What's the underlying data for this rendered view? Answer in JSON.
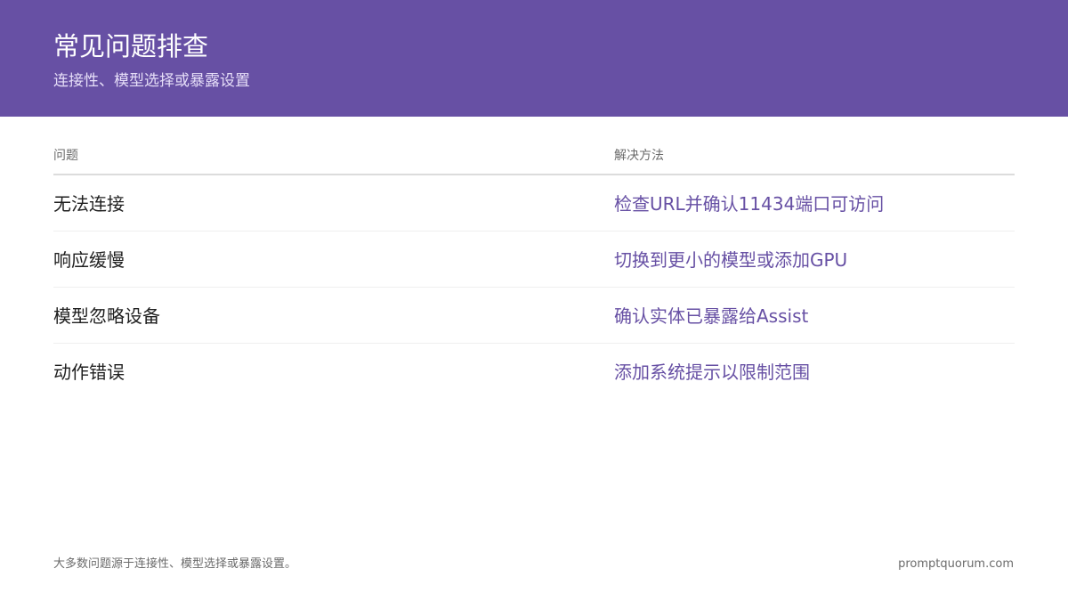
{
  "header": {
    "title": "常见问题排查",
    "subtitle": "连接性、模型选择或暴露设置"
  },
  "table": {
    "columns": [
      "问题",
      "解决方法"
    ],
    "rows": [
      {
        "issue": "无法连接",
        "fix": "检查URL并确认11434端口可访问"
      },
      {
        "issue": "响应缓慢",
        "fix": "切换到更小的模型或添加GPU"
      },
      {
        "issue": "模型忽略设备",
        "fix": "确认实体已暴露给Assist"
      },
      {
        "issue": "动作错误",
        "fix": "添加系统提示以限制范围"
      }
    ]
  },
  "footer": {
    "note": "大多数问题源于连接性、模型选择或暴露设置。",
    "brand": "promptquorum.com"
  },
  "colors": {
    "accent": "#6750a4",
    "header_bg": "#6750a4"
  }
}
